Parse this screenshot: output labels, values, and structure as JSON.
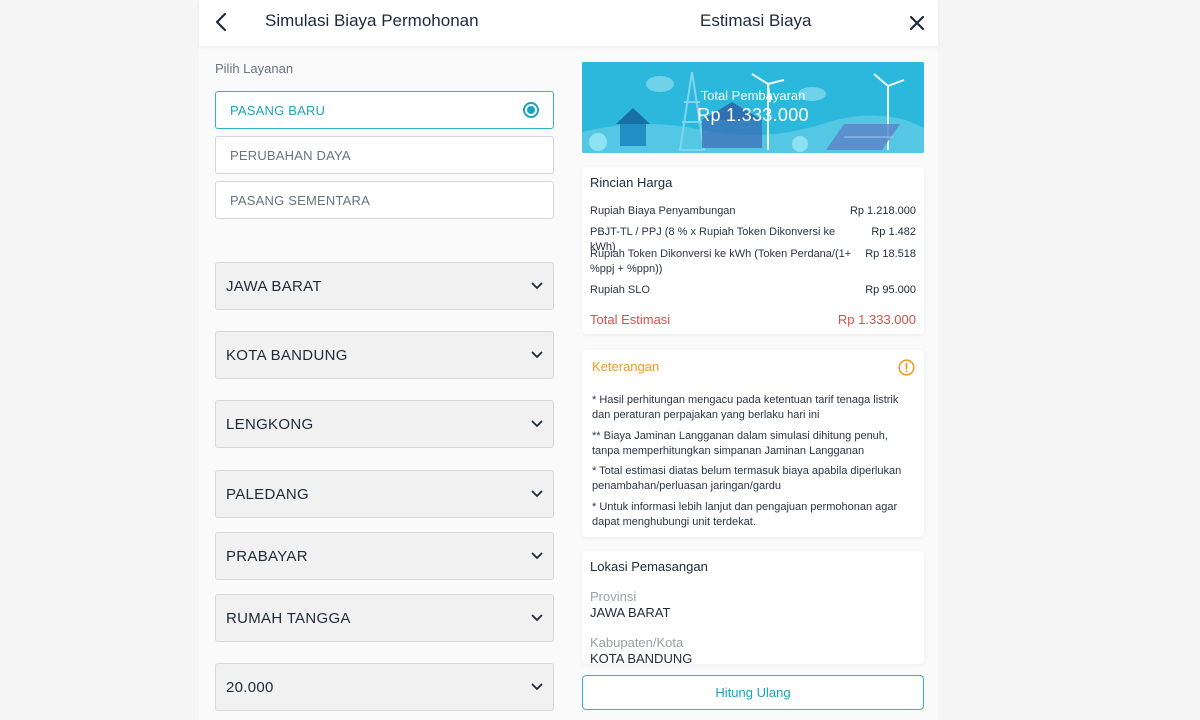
{
  "header": {
    "left_title": "Simulasi Biaya Permohonan",
    "right_title": "Estimasi Biaya"
  },
  "form": {
    "service_label": "Pilih Layanan",
    "services": [
      "PASANG BARU",
      "PERUBAHAN DAYA",
      "PASANG SEMENTARA"
    ],
    "selected_service": "PASANG BARU",
    "dropdowns": [
      "JAWA BARAT",
      "KOTA BANDUNG",
      "LENGKONG",
      "PALEDANG",
      "PRABAYAR",
      "RUMAH TANGGA",
      "20.000"
    ]
  },
  "banner": {
    "label": "Total Pembayaran",
    "value": "Rp 1.333.000"
  },
  "rincian": {
    "title": "Rincian Harga",
    "rows": [
      {
        "label": "Rupiah Biaya Penyambungan",
        "value": "Rp 1.218.000"
      },
      {
        "label": "PBJT-TL / PPJ (8 % x Rupiah Token Dikonversi ke kWh)",
        "value": "Rp 1.482"
      },
      {
        "label": "Rupiah Token Dikonversi ke kWh (Token Perdana/(1+ %ppj + %ppn))",
        "value": "Rp 18.518"
      },
      {
        "label": "Rupiah SLO",
        "value": "Rp 95.000"
      }
    ],
    "total_label": "Total Estimasi",
    "total_value": "Rp 1.333.000"
  },
  "keterangan": {
    "title": "Keterangan",
    "notes": [
      "* Hasil perhitungan mengacu pada ketentuan tarif tenaga listrik dan peraturan perpajakan yang berlaku hari ini",
      "** Biaya Jaminan Langganan dalam simulasi dihitung penuh, tanpa memperhitungkan simpanan Jaminan Langganan",
      "* Total estimasi diatas belum termasuk biaya apabila diperlukan penambahan/perluasan jaringan/gardu",
      "* Untuk informasi lebih lanjut dan pengajuan permohonan agar dapat menghubungi unit terdekat."
    ]
  },
  "lokasi": {
    "title": "Lokasi Pemasangan",
    "fields": [
      {
        "label": "Provinsi",
        "value": "JAWA BARAT"
      },
      {
        "label": "Kabupaten/Kota",
        "value": "KOTA BANDUNG"
      }
    ]
  },
  "actions": {
    "recalculate": "Hitung Ulang"
  },
  "colors": {
    "accent": "#1aa4c0",
    "warning": "#f09b2b",
    "total": "#e24b4b",
    "banner": "#29b6da"
  }
}
